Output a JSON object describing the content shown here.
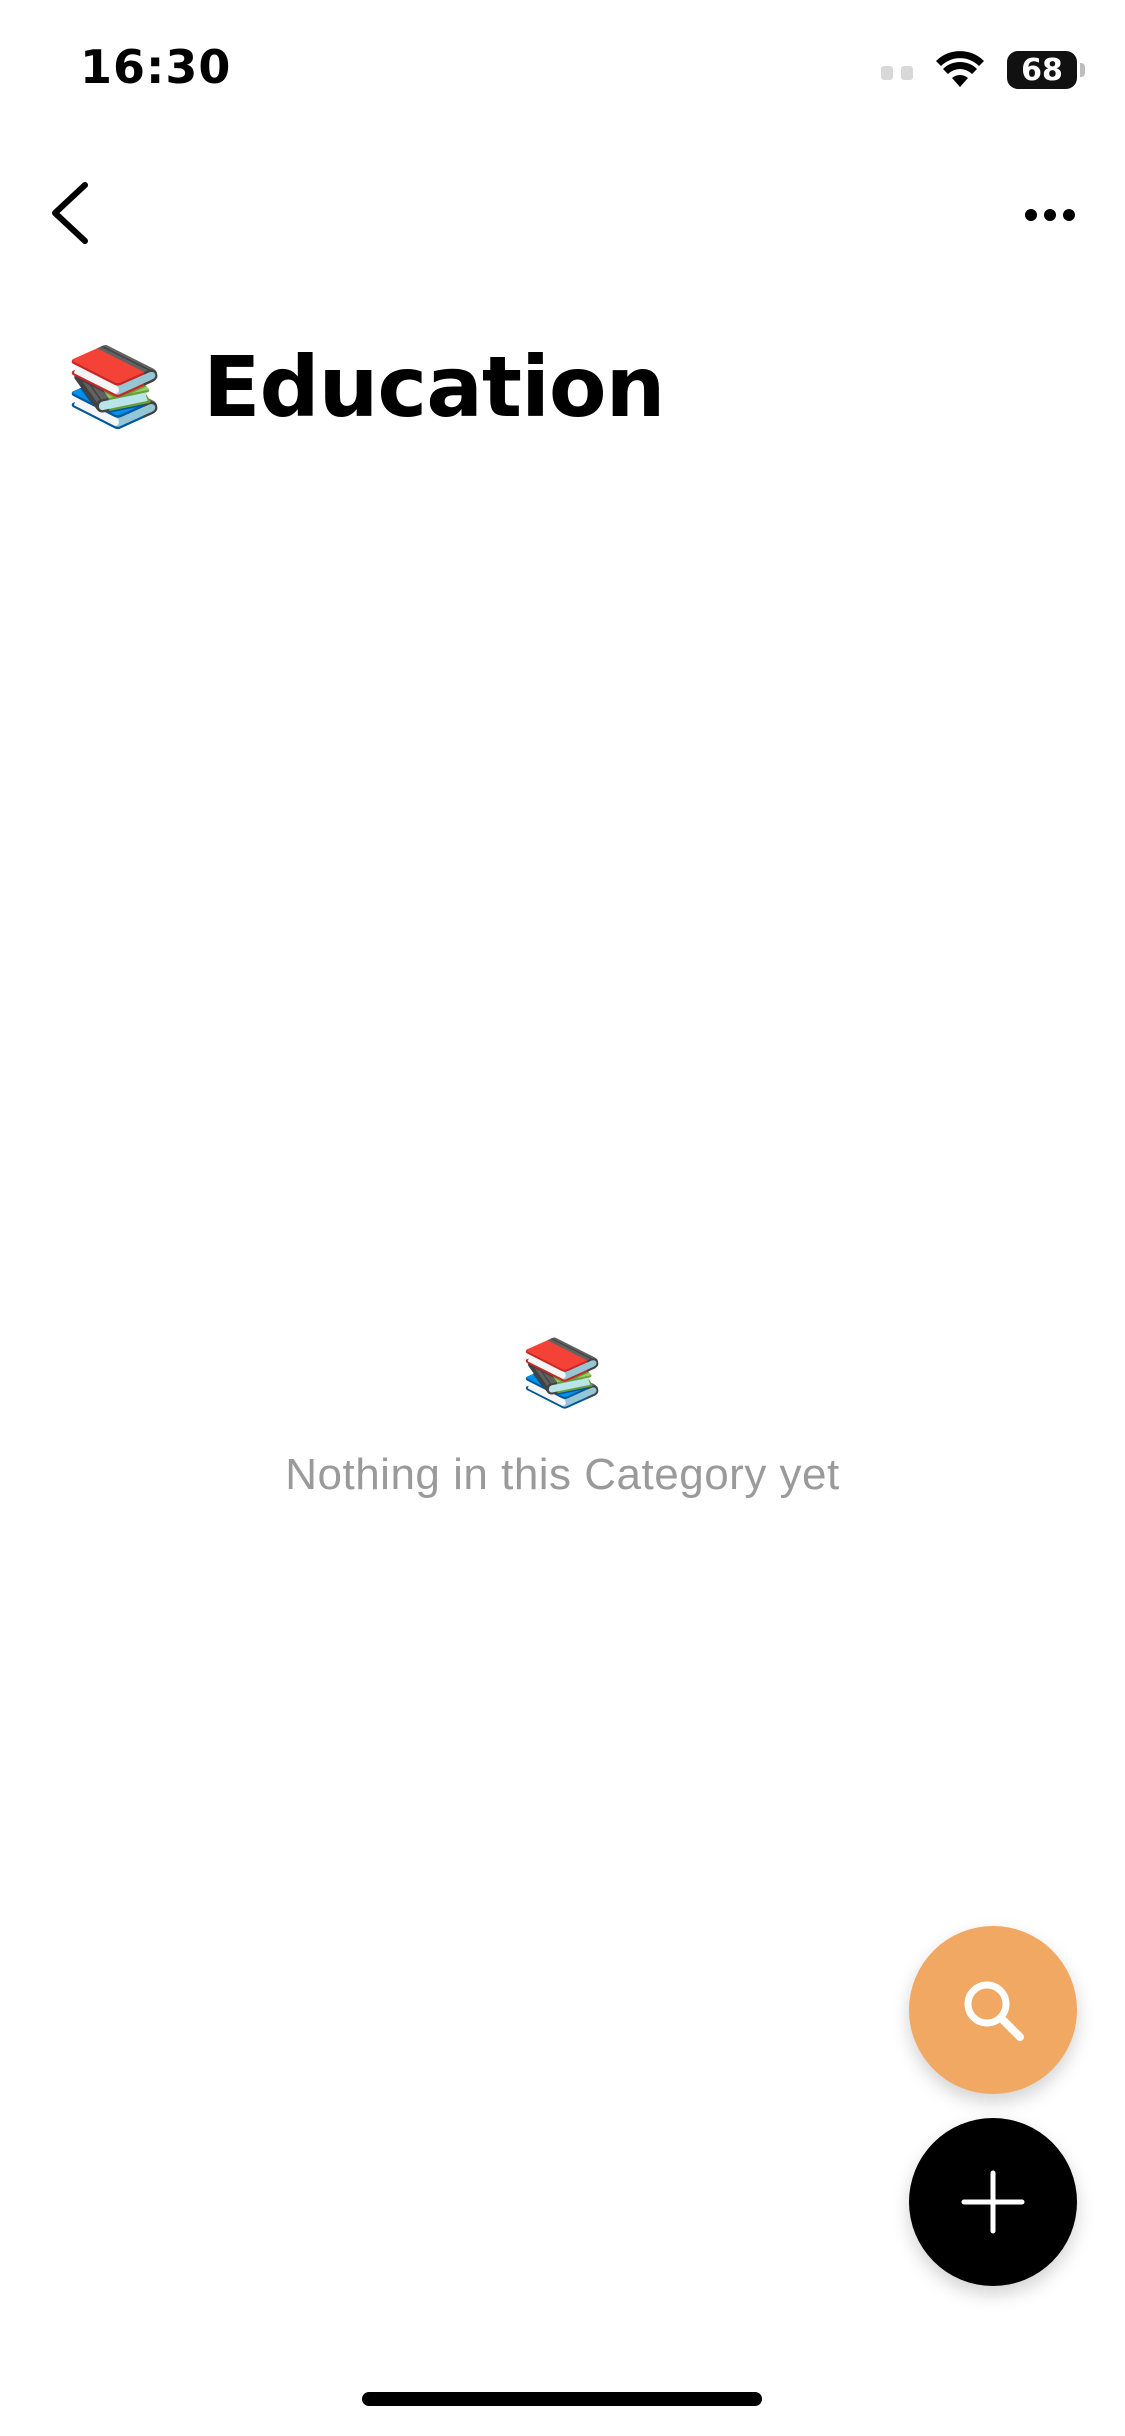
{
  "status_bar": {
    "time": "16:30",
    "battery": "68",
    "icons": [
      "signal-icon",
      "wifi-icon",
      "battery-icon"
    ]
  },
  "nav": {
    "back_icon": "chevron-left-icon",
    "more_icon": "ellipsis-icon"
  },
  "page": {
    "emoji": "📚",
    "title": "Education"
  },
  "empty_state": {
    "emoji": "📚",
    "message": "Nothing in this Category yet"
  },
  "fabs": {
    "search_icon": "search-icon",
    "add_icon": "plus-icon"
  },
  "colors": {
    "background": "#ffffff",
    "search_fab": "#f0a862",
    "add_fab": "#000000",
    "empty_text": "#9a9a9a"
  }
}
